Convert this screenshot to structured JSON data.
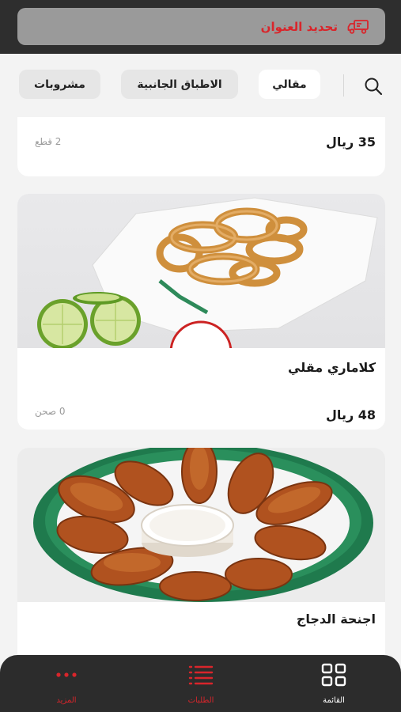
{
  "header": {
    "address_label": "تحديد العنوان"
  },
  "categories": {
    "items": [
      {
        "label": "مقالي",
        "active": true
      },
      {
        "label": "الاطباق الجانبية",
        "active": false
      },
      {
        "label": "مشروبات",
        "active": false
      }
    ]
  },
  "products": [
    {
      "title": "",
      "price": "35 ريال",
      "unit": "2 قطع"
    },
    {
      "title": "كلاماري مقلي",
      "price": "48 ريال",
      "unit": "0 صحن"
    },
    {
      "title": "اجنحة الدجاج",
      "price": "",
      "unit": ""
    }
  ],
  "bottom_nav": {
    "menu_label": "القائمة",
    "orders_label": "الطلبات",
    "more_label": "المزيد"
  },
  "colors": {
    "accent": "#d9252b",
    "header_bg": "#2e2e2e",
    "nav_bg": "#2c2c2c"
  }
}
